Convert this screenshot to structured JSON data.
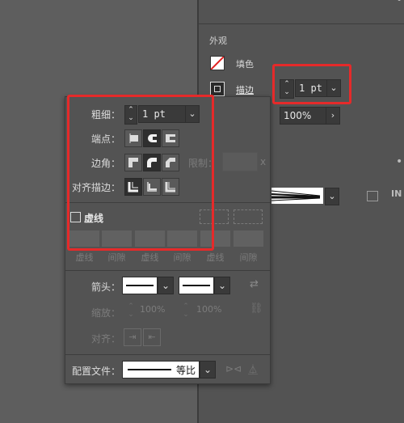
{
  "appearance_panel": {
    "title": "外观",
    "fill_label": "填色",
    "stroke_label": "描边",
    "stroke_weight": "1 pt",
    "opacity": "100%"
  },
  "stroke_popup": {
    "weight_label": "粗细：",
    "weight_value": "1 pt",
    "cap_label": "端点：",
    "corner_label": "边角：",
    "limit_label": "限制：",
    "limit_unit": "x",
    "align_label": "对齐描边：",
    "dashed_label": "虚线",
    "dash_labels": [
      "虚线",
      "间隙",
      "虚线",
      "间隙",
      "虚线",
      "间隙"
    ],
    "arrow_label": "箭头：",
    "scale_label": "缩放：",
    "scale_start": "100%",
    "scale_end": "100%",
    "align_arrow_label": "对齐：",
    "profile_label": "配置文件：",
    "profile_value": "等比"
  },
  "colors": {
    "highlight": "#e52a2a",
    "panel": "#535353",
    "field": "#3a3a3a"
  }
}
